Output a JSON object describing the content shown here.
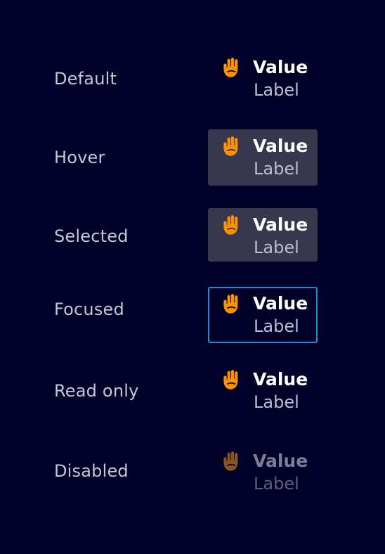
{
  "colors": {
    "background": "#000028",
    "icon_orange": "#ff9000",
    "icon_disabled": "#8a5521",
    "hover_fill": "#37374d",
    "focus_border": "#1f8be0"
  },
  "states": [
    {
      "state": "Default",
      "value": "Value",
      "label": "Label",
      "icon": "hand-icon"
    },
    {
      "state": "Hover",
      "value": "Value",
      "label": "Label",
      "icon": "hand-icon"
    },
    {
      "state": "Selected",
      "value": "Value",
      "label": "Label",
      "icon": "hand-icon"
    },
    {
      "state": "Focused",
      "value": "Value",
      "label": "Label",
      "icon": "hand-icon"
    },
    {
      "state": "Read only",
      "value": "Value",
      "label": "Label",
      "icon": "hand-icon"
    },
    {
      "state": "Disabled",
      "value": "Value",
      "label": "Label",
      "icon": "hand-icon"
    }
  ]
}
